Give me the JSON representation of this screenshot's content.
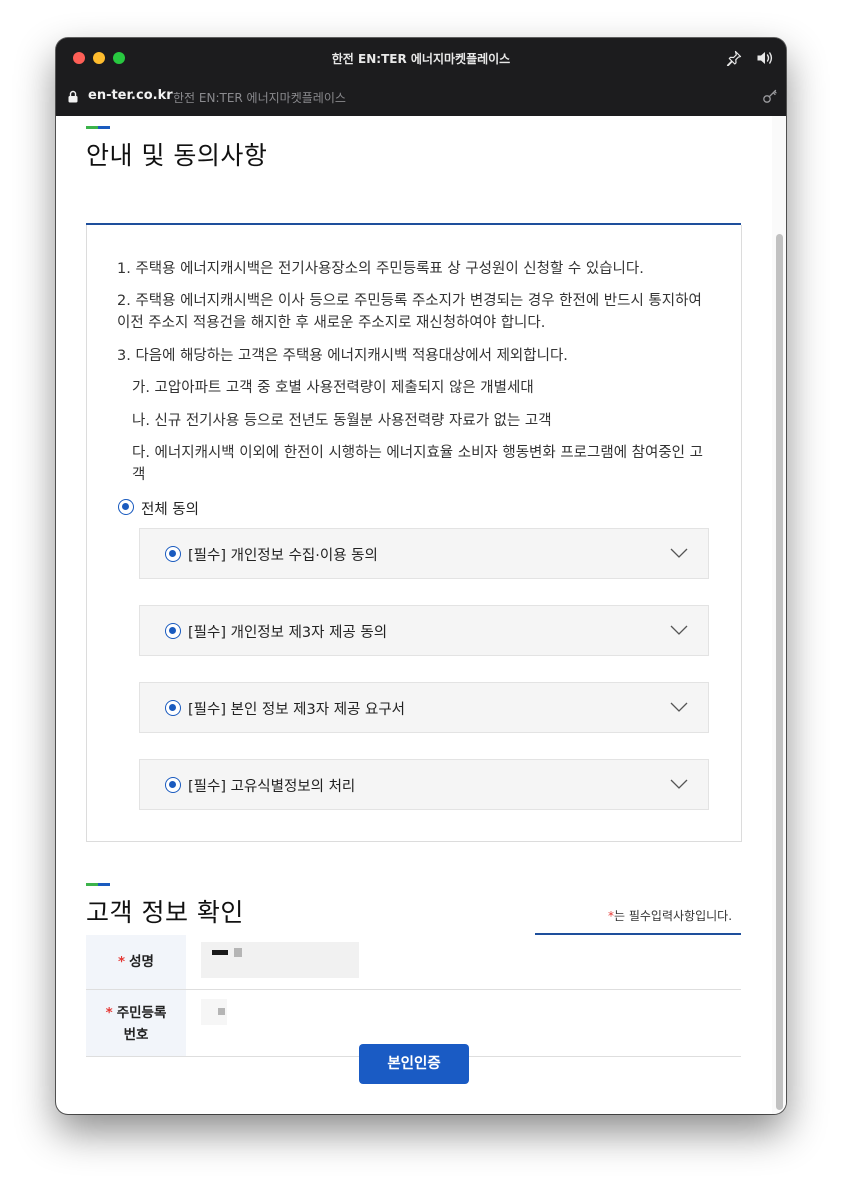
{
  "window": {
    "title": "한전 EN:TER 에너지마켓플레이스",
    "url_domain": "en-ter.co.kr",
    "url_title": "한전 EN:TER 에너지마켓플레이스"
  },
  "notice_section": {
    "title": "안내 및 동의사항",
    "items": [
      "1. 주택용 에너지캐시백은 전기사용장소의 주민등록표 상 구성원이 신청할 수 있습니다.",
      "2. 주택용 에너지캐시백은 이사 등으로 주민등록 주소지가 변경되는 경우 한전에 반드시 통지하여 이전 주소지 적용건을 해지한 후 새로운 주소지로 재신청하여야 합니다.",
      "3. 다음에 해당하는 고객은 주택용 에너지캐시백 적용대상에서 제외합니다."
    ],
    "sub_items": [
      "가. 고압아파트 고객 중 호별 사용전력량이 제출되지 않은 개별세대",
      "나. 신규 전기사용 등으로 전년도 동월분 사용전력량 자료가 없는 고객",
      "다. 에너지캐시백 이외에 한전이 시행하는 에너지효율 소비자 행동변화 프로그램에 참여중인 고객"
    ],
    "agree_all_label": "전체 동의",
    "agreements": [
      "[필수] 개인정보 수집·이용 동의",
      "[필수] 개인정보 제3자 제공 동의",
      "[필수] 본인 정보 제3자 제공 요구서",
      "[필수] 고유식별정보의 처리"
    ]
  },
  "customer_section": {
    "title": "고객 정보 확인",
    "required_star": "*",
    "required_note": "는 필수입력사항입니다.",
    "name_label": "성명",
    "rrn_label": "주민등록\n번호",
    "verify_button": "본인인증"
  },
  "colors": {
    "accent_blue": "#1a5bbf",
    "accent_green": "#3cb34a",
    "required_red": "#e53935",
    "button_blue": "#1a5bc4"
  }
}
